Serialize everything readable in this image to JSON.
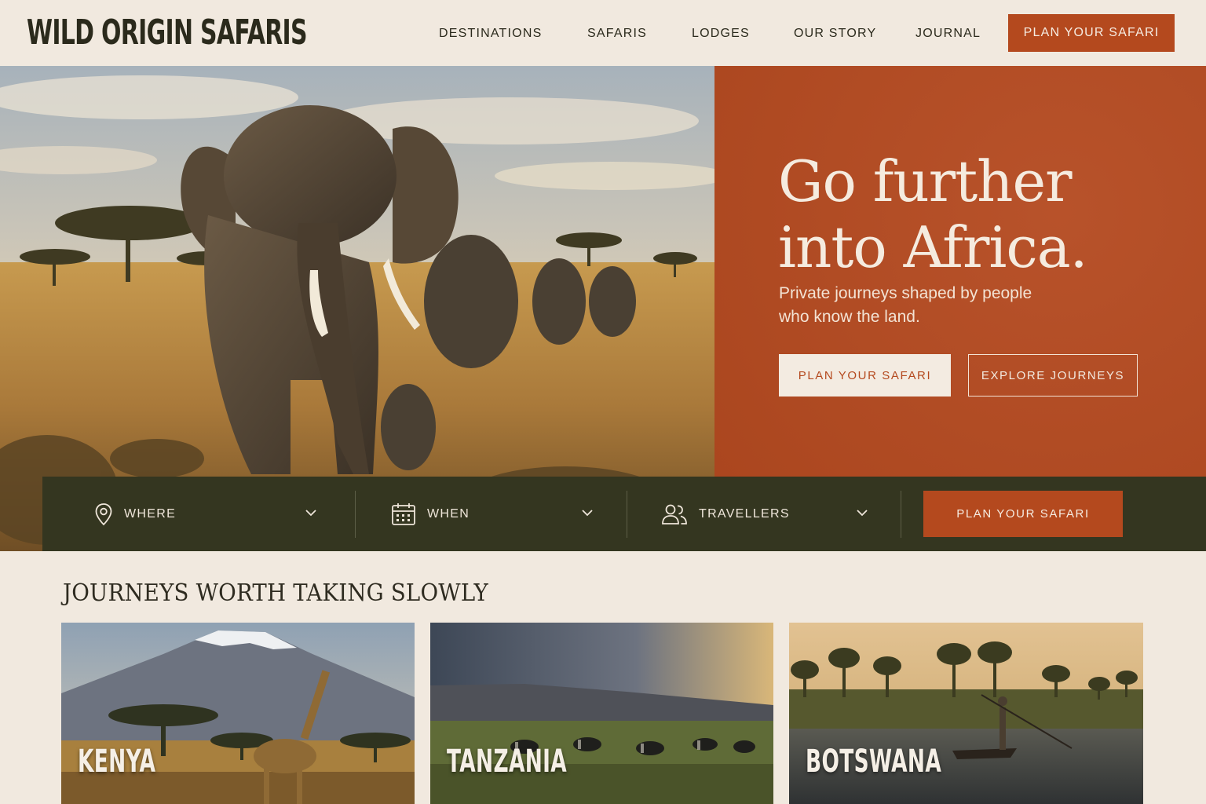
{
  "header": {
    "logo": "WILD ORIGIN SAFARIS",
    "nav": [
      "DESTINATIONS",
      "SAFARIS",
      "LODGES",
      "OUR STORY",
      "JOURNAL"
    ],
    "cta": "PLAN YOUR SAFARI"
  },
  "hero": {
    "title_line1": "Go further",
    "title_line2": "into Africa.",
    "subtitle": "Private journeys shaped by people who know the land.",
    "primary_button": "PLAN YOUR SAFARI",
    "secondary_button": "EXPLORE JOURNEYS"
  },
  "search": {
    "where": "WHERE",
    "when": "WHEN",
    "travellers": "TRAVELLERS",
    "cta": "PLAN YOUR SAFARI"
  },
  "journeys": {
    "title": "JOURNEYS WORTH TAKING SLOWLY",
    "cards": [
      {
        "label": "KENYA"
      },
      {
        "label": "TANZANIA"
      },
      {
        "label": "BOTSWANA"
      }
    ]
  },
  "colors": {
    "background": "#f1e9df",
    "accent": "#b4491e",
    "dark_olive": "#343620",
    "text_dark": "#2b2a1c"
  }
}
